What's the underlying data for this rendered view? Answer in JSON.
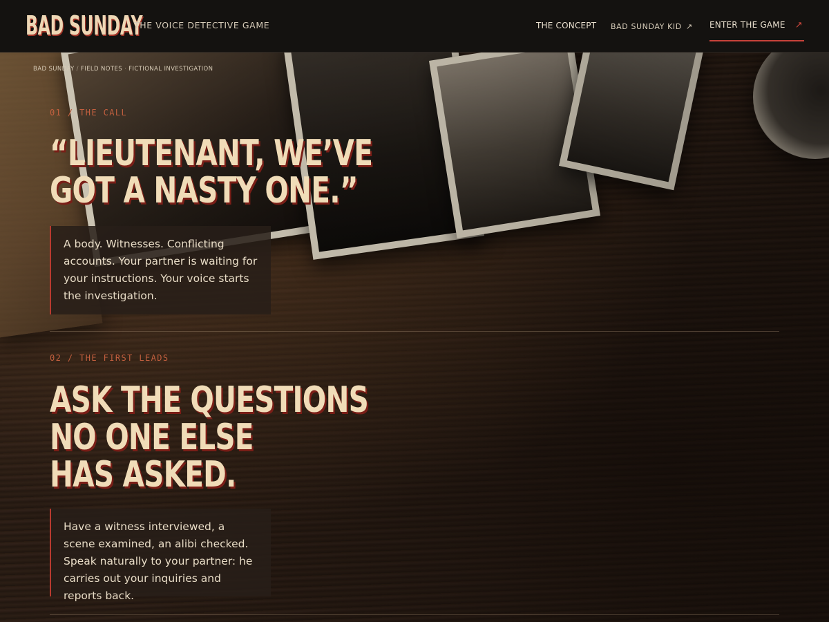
{
  "header": {
    "logo": "BAD SUNDAY",
    "tagline": "THE VOICE DETECTIVE GAME",
    "nav": {
      "concept": "THE CONCEPT",
      "kid": "BAD SUNDAY KID",
      "kid_icon": "↗",
      "game": "ENTER THE GAME",
      "game_icon": "↗"
    }
  },
  "breadcrumb": {
    "items": [
      "BAD SUNDAY",
      "FIELD NOTES",
      "FICTIONAL INVESTIGATION"
    ],
    "separators": [
      "/",
      "·"
    ]
  },
  "sections": [
    {
      "kicker": "01 / THE CALL",
      "headline_lines": [
        "“LIEUTENANT, WE’VE",
        "GOT A NASTY ONE.”"
      ],
      "body": "A body. Witnesses. Conflicting accounts. Your partner is waiting for your instructions. Your voice starts the investigation."
    },
    {
      "kicker": "02 / THE FIRST LEADS",
      "headline_lines": [
        "ASK THE QUESTIONS",
        "NO ONE ELSE",
        "HAS ASKED."
      ],
      "body": "Have a witness interviewed, a scene examined, an alibi checked. Speak naturally to your partner: he carries out your inquiries and reports back."
    }
  ],
  "colors": {
    "accent": "#c8423a",
    "headline": "#f0dcb8",
    "kicker": "#c4603f",
    "header_bg": "#141210"
  },
  "icons": {
    "kid_link": "external-link-arrow-icon",
    "game_link": "external-link-arrow-icon"
  }
}
